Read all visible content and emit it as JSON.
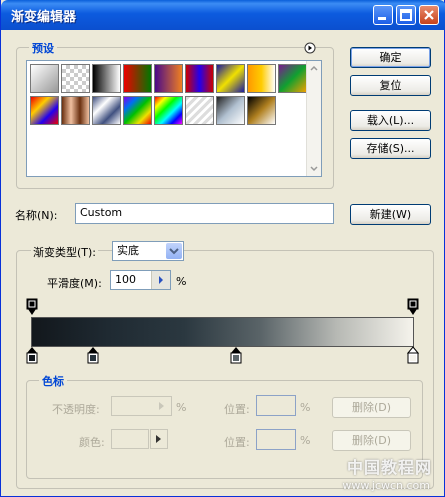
{
  "window": {
    "title": "渐变编辑器"
  },
  "presets": {
    "legend": "预设",
    "menu_icon": "circle-arrow-icon",
    "swatches": [
      "linear-gradient(135deg,#fff,#999)",
      "repeating-conic-gradient(#ccc 0 25%,#fff 0 50%) 0 0/8px 8px",
      "linear-gradient(90deg,#000,#fff)",
      "linear-gradient(90deg,#e00,#070)",
      "linear-gradient(90deg,#4a0a8a,#f08020)",
      "linear-gradient(90deg,#c00,#20e,#c00)",
      "linear-gradient(135deg,#1a1aa0,#f0e000,#1a1aa0)",
      "linear-gradient(90deg,#f90,#fc0,#fff)",
      "linear-gradient(135deg,#7a1a90,#10a030,#f0a000)",
      "linear-gradient(135deg,#e00,#fc0,#20e,#e00)",
      "linear-gradient(90deg,#6a3010,#f0c0a0,#6a3010,#f0c0a0)",
      "linear-gradient(135deg,#405080,#fff,#405080,#fff)",
      "linear-gradient(135deg,#8000f0,#0070f0,#00c000,#f0e000,#f00000)",
      "linear-gradient(135deg,#f00,#ff0,#0f0,#0ff,#00f,#f0f)",
      "repeating-linear-gradient(135deg,#ddd 0 3px,#fff 3px 6px)",
      "linear-gradient(135deg,#222,#b0c0d0,#fff)",
      "linear-gradient(135deg,#000,#b08020,#fff)"
    ]
  },
  "buttons": {
    "ok": "确定",
    "reset": "复位",
    "load": "载入(L)...",
    "save": "存储(S)...",
    "new": "新建(W)"
  },
  "name": {
    "label": "名称(N):",
    "value": "Custom"
  },
  "gradient_type": {
    "legend_label": "渐变类型(T):",
    "selected": "实底",
    "smoothness_label": "平滑度(M):",
    "smoothness_value": "100",
    "percent": "%"
  },
  "stops": {
    "legend": "色标",
    "opacity_label": "不透明度:",
    "opacity_percent": "%",
    "location_label_1": "位置:",
    "location_percent_1": "%",
    "delete_label_1": "删除(D)",
    "color_label": "颜色:",
    "location_label_2": "位置:",
    "location_percent_2": "%",
    "delete_label_2": "删除(D)"
  },
  "watermark": {
    "text": "中国教程网",
    "url": "www.jcwcn.com"
  },
  "colors": {
    "title_blue": "#0A5FDA",
    "group_legend": "#0046D5",
    "dialog_bg": "#ECE9D8"
  }
}
